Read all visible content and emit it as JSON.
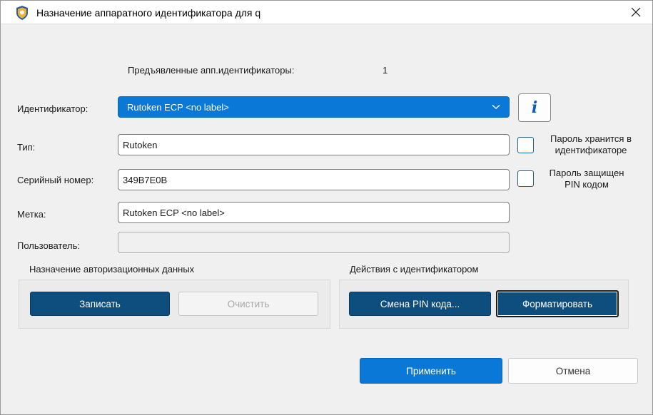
{
  "window": {
    "title": "Назначение аппаратного идентификатора для q"
  },
  "presented": {
    "label": "Предъявленные апп.идентификаторы:",
    "count": "1"
  },
  "fields": {
    "identifier_label": "Идентификатор:",
    "identifier_value": "Rutoken ECP <no label>",
    "type_label": "Тип:",
    "type_value": "Rutoken",
    "serial_label": "Серийный номер:",
    "serial_value": "349B7E0B",
    "mark_label": "Метка:",
    "mark_value": "Rutoken ECP <no label>",
    "user_label": "Пользователь:",
    "user_value": ""
  },
  "checkboxes": {
    "password_stored": {
      "label_line1": "Пароль хранится в",
      "label_line2": "идентификаторе",
      "checked": false
    },
    "password_pin": {
      "label_line1": "Пароль защищен",
      "label_line2": "PIN кодом",
      "checked": false
    }
  },
  "auth_group": {
    "title": "Назначение авторизационных данных",
    "write_button": "Записать",
    "clear_button": "Очистить"
  },
  "actions_group": {
    "title": "Действия с идентификатором",
    "change_pin_button": "Смена PIN кода...",
    "format_button": "Форматировать"
  },
  "footer": {
    "apply_button": "Применить",
    "cancel_button": "Отмена"
  },
  "colors": {
    "accent": "#0a78d7",
    "dark_button": "#0e4e7e",
    "background": "#f0f0f0"
  },
  "icons": {
    "app": "shield-icon",
    "close": "close-icon",
    "dropdown": "chevron-down-icon",
    "info": "info-icon"
  }
}
